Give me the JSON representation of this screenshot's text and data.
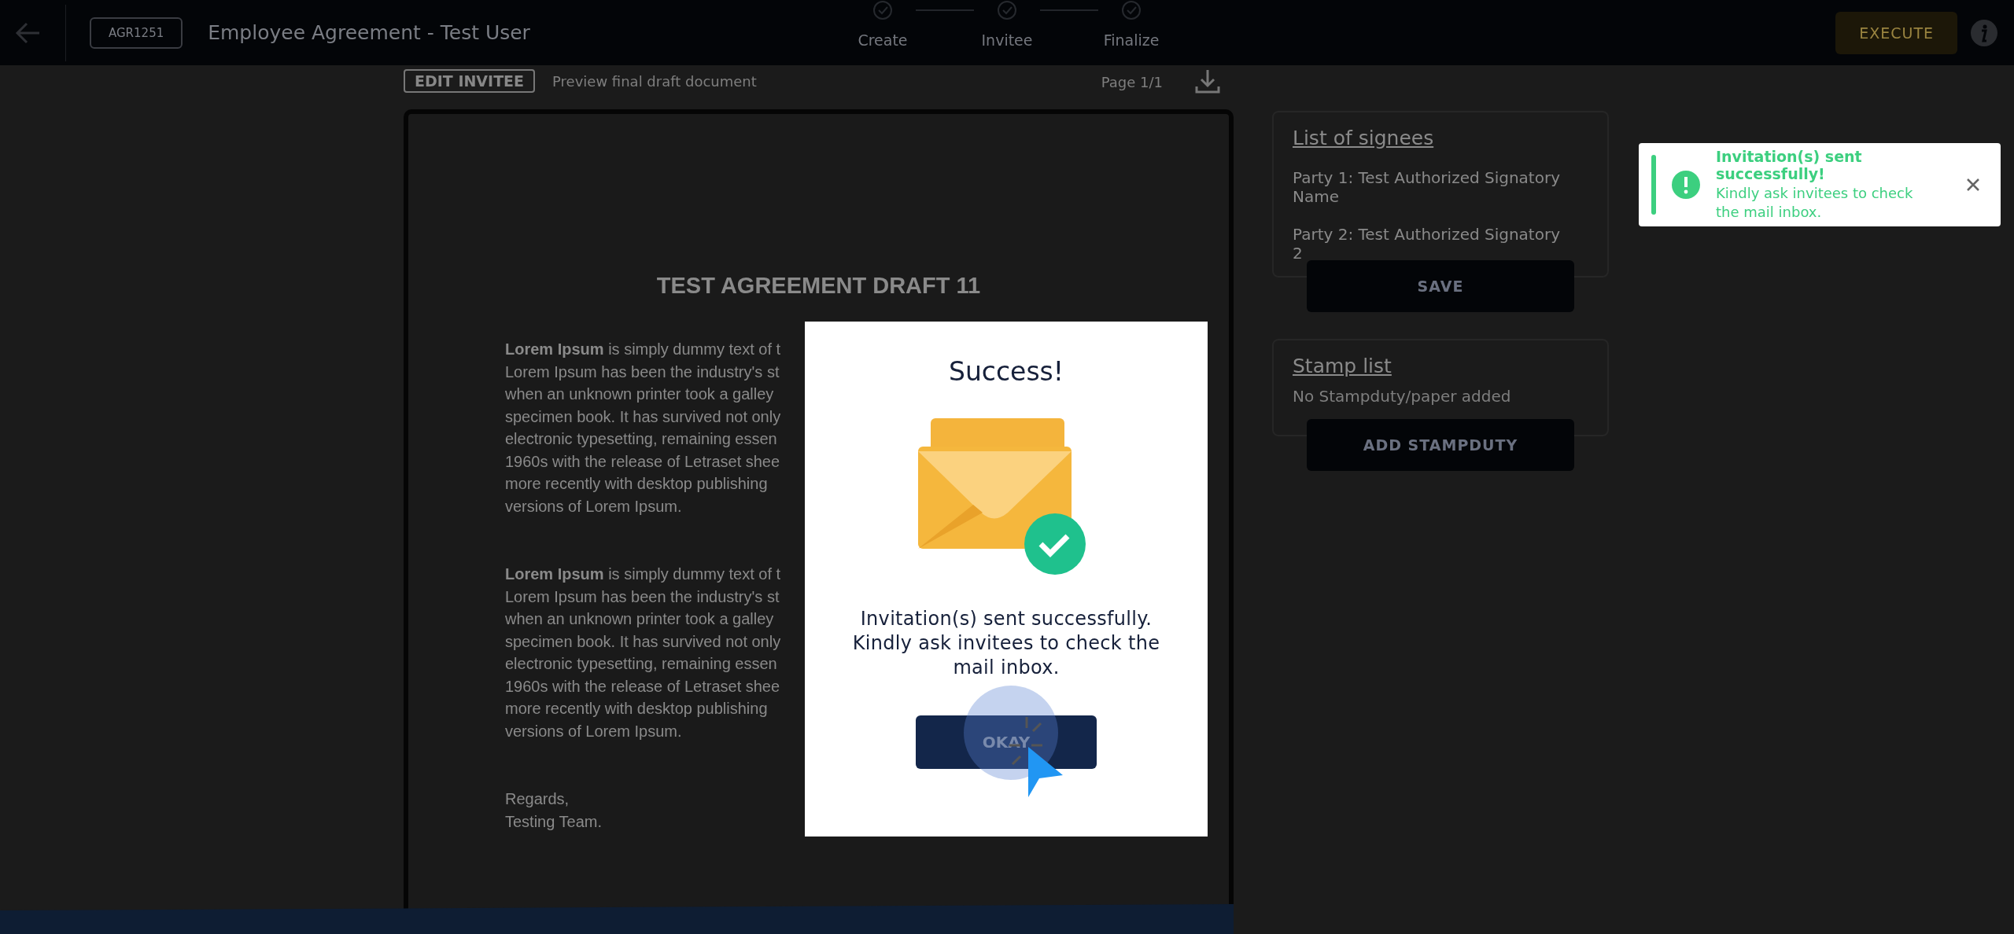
{
  "top_bar": {
    "document_id": "AGR1251",
    "title": "Employee Agreement - Test User",
    "steps": [
      {
        "label": "Create",
        "done": true
      },
      {
        "label": "Invitee",
        "done": true
      },
      {
        "label": "Finalize",
        "done": true
      }
    ],
    "execute_button": "EXECUTE"
  },
  "toolbar": {
    "edit_button": "EDIT INVITEE",
    "caption": "Preview final draft document",
    "page": "Page 1/1"
  },
  "document": {
    "heading": "TEST AGREEMENT DRAFT 11",
    "paragraphs": [
      {
        "lines": [
          "**Lorem Ipsum** is simply dummy text of t",
          "Lorem Ipsum has been the industry's st",
          "when an unknown printer took a galley",
          "specimen book. It has survived not only",
          "electronic typesetting, remaining essen",
          "1960s with the release of Letraset shee",
          "more recently with desktop publishing",
          "versions of Lorem Ipsum."
        ]
      },
      {
        "lines": [
          "**Lorem Ipsum** is simply dummy text of t",
          "Lorem Ipsum has been the industry's st",
          "when an unknown printer took a galley",
          "specimen book. It has survived not only",
          "electronic typesetting, remaining essen",
          "1960s with the release of Letraset shee",
          "more recently with desktop publishing",
          "versions of Lorem Ipsum."
        ]
      }
    ],
    "closing": [
      "Regards,",
      "Testing Team."
    ]
  },
  "signees_card": {
    "title": "List of signees",
    "parties": [
      "Party 1: Test Authorized Signatory Name",
      "Party 2: Test Authorized Signatory 2"
    ],
    "button": "SAVE"
  },
  "stamp_card": {
    "title": "Stamp list",
    "empty_text": "No Stampduty/paper added",
    "button": "ADD STAMPDUTY"
  },
  "modal": {
    "title": "Success!",
    "message": "Invitation(s) sent successfully. Kindly ask invitees to check the mail inbox.",
    "button": "OKAY"
  },
  "toast": {
    "title": "Invitation(s) sent successfully!",
    "message": "Kindly ask invitees to check the mail inbox."
  }
}
